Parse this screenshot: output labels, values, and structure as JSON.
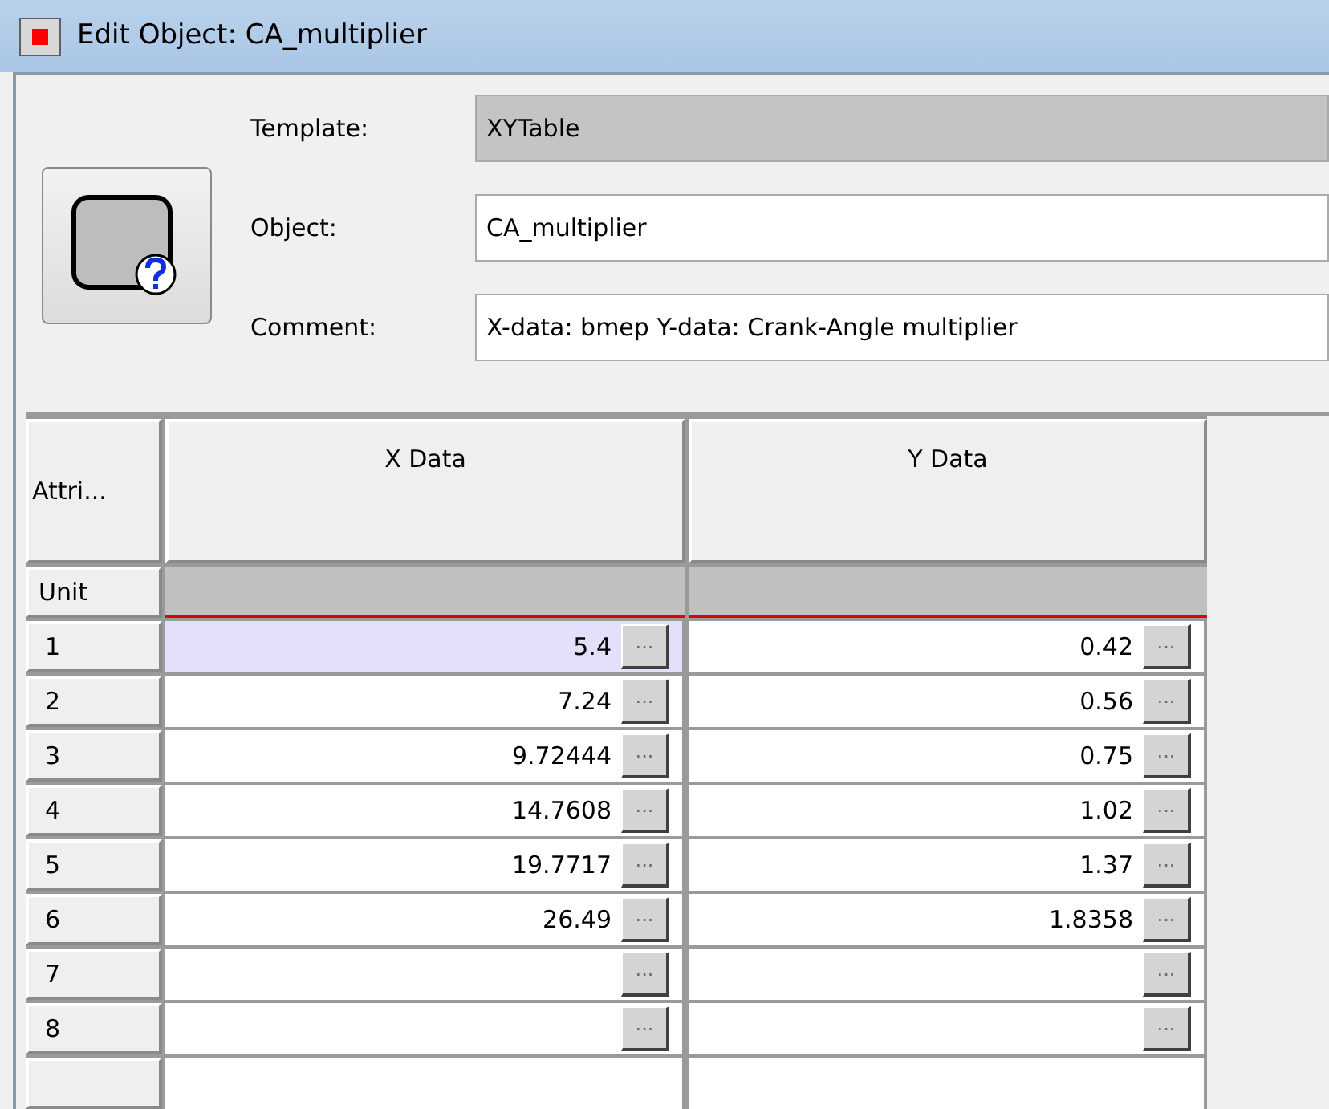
{
  "window": {
    "title": "Edit Object: CA_multiplier"
  },
  "fields": [
    {
      "label": "Template:",
      "value": "XYTable",
      "disabled": true
    },
    {
      "label": "Object:",
      "value": "CA_multiplier",
      "disabled": false
    },
    {
      "label": "Comment:",
      "value": "X-data: bmep Y-data: Crank-Angle multiplier",
      "disabled": false
    }
  ],
  "table": {
    "columns": [
      "Attri...",
      "X Data",
      "Y Data"
    ],
    "unit_label": "Unit",
    "rows": [
      {
        "label": "1",
        "x": {
          "value": "5.4",
          "button": "...",
          "selected": true
        },
        "y": {
          "value": "0.42",
          "button": "...",
          "selected": false
        }
      },
      {
        "label": "2",
        "x": {
          "value": "7.24",
          "button": "...",
          "selected": false
        },
        "y": {
          "value": "0.56",
          "button": "...",
          "selected": false
        }
      },
      {
        "label": "3",
        "x": {
          "value": "9.72444",
          "button": "...",
          "selected": false
        },
        "y": {
          "value": "0.75",
          "button": "...",
          "selected": false
        }
      },
      {
        "label": "4",
        "x": {
          "value": "14.7608",
          "button": "...",
          "selected": false
        },
        "y": {
          "value": "1.02",
          "button": "...",
          "selected": false
        }
      },
      {
        "label": "5",
        "x": {
          "value": "19.7717",
          "button": "...",
          "selected": false
        },
        "y": {
          "value": "1.37",
          "button": "...",
          "selected": false
        }
      },
      {
        "label": "6",
        "x": {
          "value": "26.49",
          "button": "...",
          "selected": false
        },
        "y": {
          "value": "1.8358",
          "button": "...",
          "selected": false
        }
      },
      {
        "label": "7",
        "x": {
          "button": "...",
          "selected": false
        },
        "y": {
          "button": "...",
          "selected": false
        }
      },
      {
        "label": "8",
        "x": {
          "button": "...",
          "selected": false
        },
        "y": {
          "button": "...",
          "selected": false
        }
      }
    ]
  }
}
